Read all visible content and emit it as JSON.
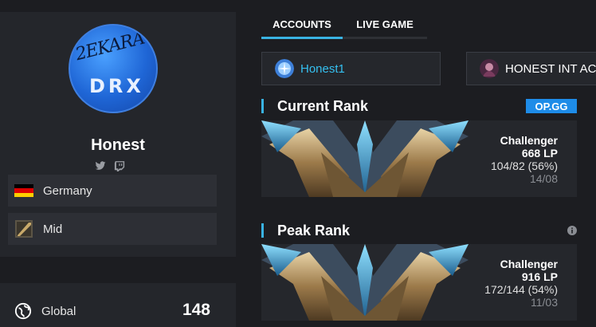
{
  "profile": {
    "name": "Honest",
    "avatar_text_script": "2EKARA",
    "avatar_text_logo": "DRX",
    "country": "Germany",
    "role": "Mid",
    "global_label": "Global",
    "global_value": "148"
  },
  "tabs": [
    {
      "label": "ACCOUNTS"
    },
    {
      "label": "LIVE GAME"
    }
  ],
  "accounts": [
    {
      "name": "Honest1"
    },
    {
      "name": "HONEST INT AC"
    }
  ],
  "current_rank": {
    "title": "Current Rank",
    "badge": "OP.GG",
    "tier": "Challenger",
    "lp": "668 LP",
    "record": "104/82 (56%)",
    "date": "14/08"
  },
  "peak_rank": {
    "title": "Peak Rank",
    "tier": "Challenger",
    "lp": "916 LP",
    "record": "172/144 (54%)",
    "date": "11/03"
  },
  "colors": {
    "accent": "#39b3e3",
    "badge": "#1e8ce8",
    "account_link": "#35c0f0"
  }
}
